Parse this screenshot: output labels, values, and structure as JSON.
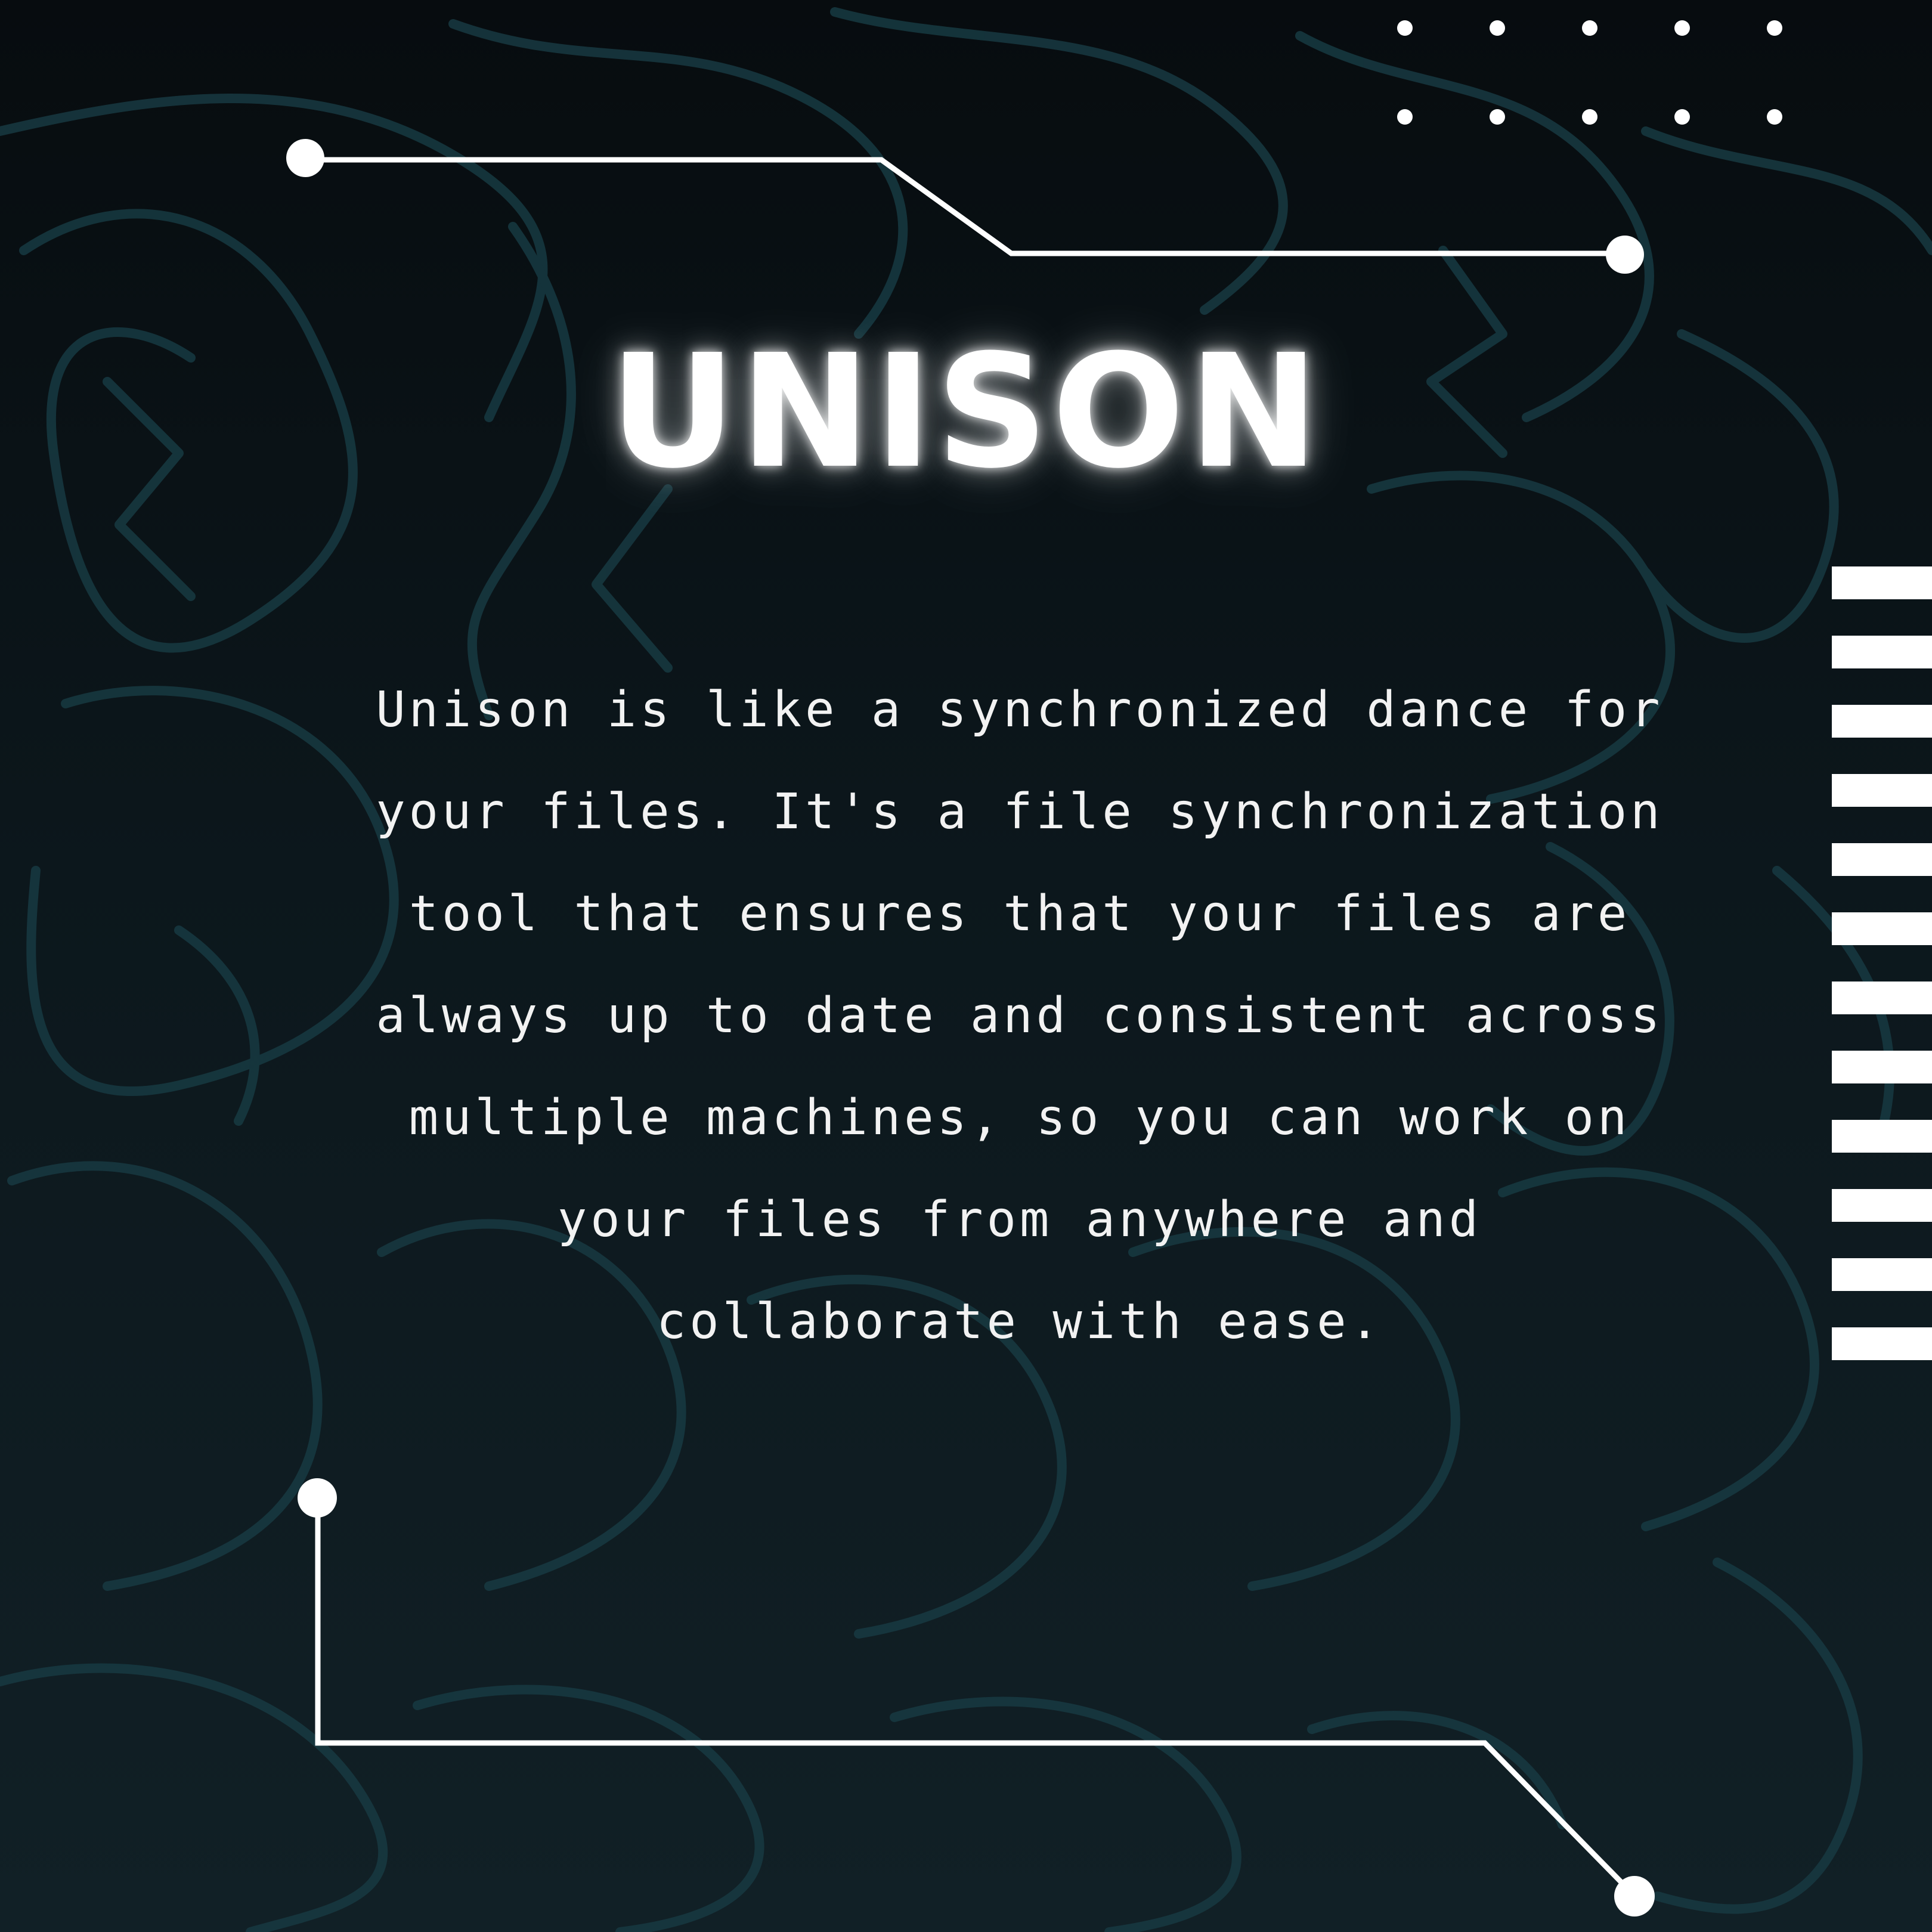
{
  "title": "UNISON",
  "body": "Unison is like a synchronized dance for\nyour files. It's a file synchronization\ntool that ensures that your files are\nalways up to date and consistent across\nmultiple machines, so you can work on\nyour files from anywhere and\ncollaborate with ease.",
  "colors": {
    "background": "#0b1216",
    "pattern": "#173a42",
    "foreground": "#ffffff"
  },
  "icons": {
    "dot_grid": "dot-grid-decoration",
    "stripes": "striped-bar-decoration",
    "circuit": "circuit-line-decoration"
  }
}
